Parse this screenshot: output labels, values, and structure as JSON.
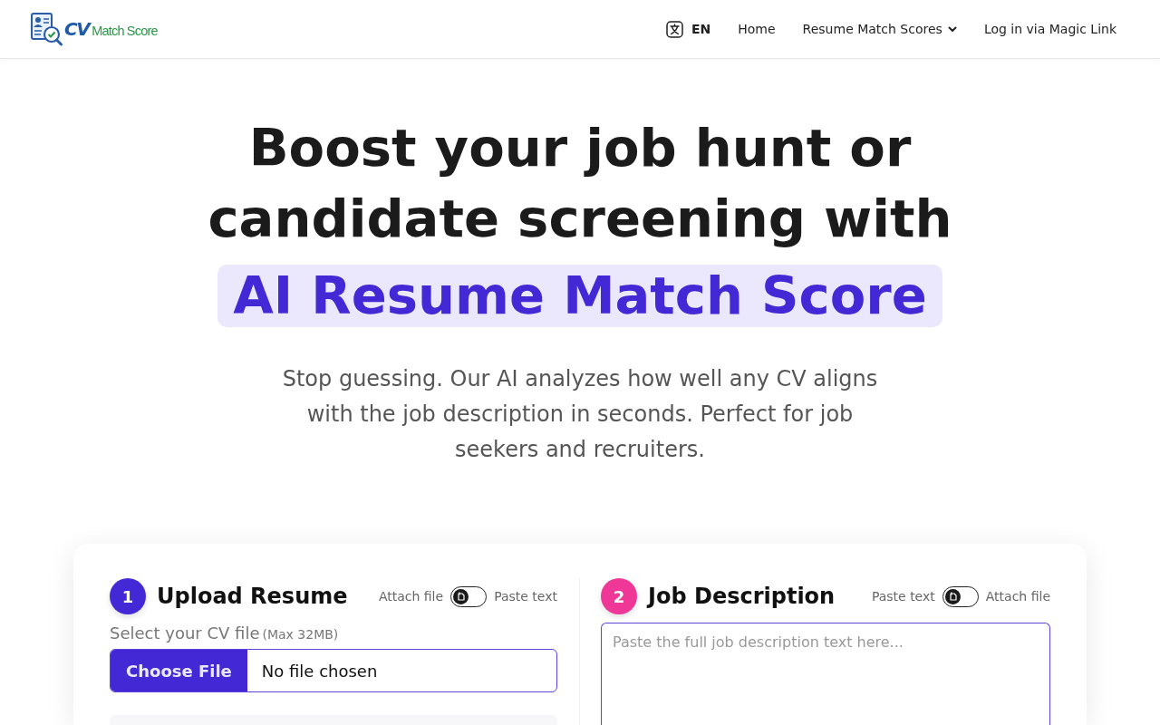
{
  "header": {
    "logo": {
      "mark": "CV",
      "text": "Match Score"
    },
    "language": {
      "code": "EN"
    },
    "nav": [
      {
        "label": "Home",
        "kind": "link"
      },
      {
        "label": "Resume Match Scores",
        "kind": "dropdown"
      },
      {
        "label": "Log in via Magic Link",
        "kind": "link"
      }
    ]
  },
  "hero": {
    "title": "Boost your job hunt or candidate screening with",
    "highlight": "AI Resume Match Score",
    "subtitle": "Stop guessing. Our AI analyzes how well any CV aligns with the job description in seconds. Perfect for job seekers and recruiters."
  },
  "form": {
    "sections": [
      {
        "step": "1",
        "color": "#4329d6",
        "title": "Upload Resume",
        "toggle": {
          "left": "Attach file",
          "right": "Paste text",
          "on": false
        },
        "input": {
          "kind": "file",
          "label": "Select your CV file",
          "hint": "(Max 32MB)",
          "button": "Choose File",
          "value": "No file chosen"
        }
      },
      {
        "step": "2",
        "color": "#ee3797",
        "title": "Job Description",
        "toggle": {
          "left": "Paste text",
          "right": "Attach file",
          "on": false
        },
        "input": {
          "kind": "textarea",
          "placeholder": "Paste the full job description text here..."
        }
      }
    ]
  }
}
